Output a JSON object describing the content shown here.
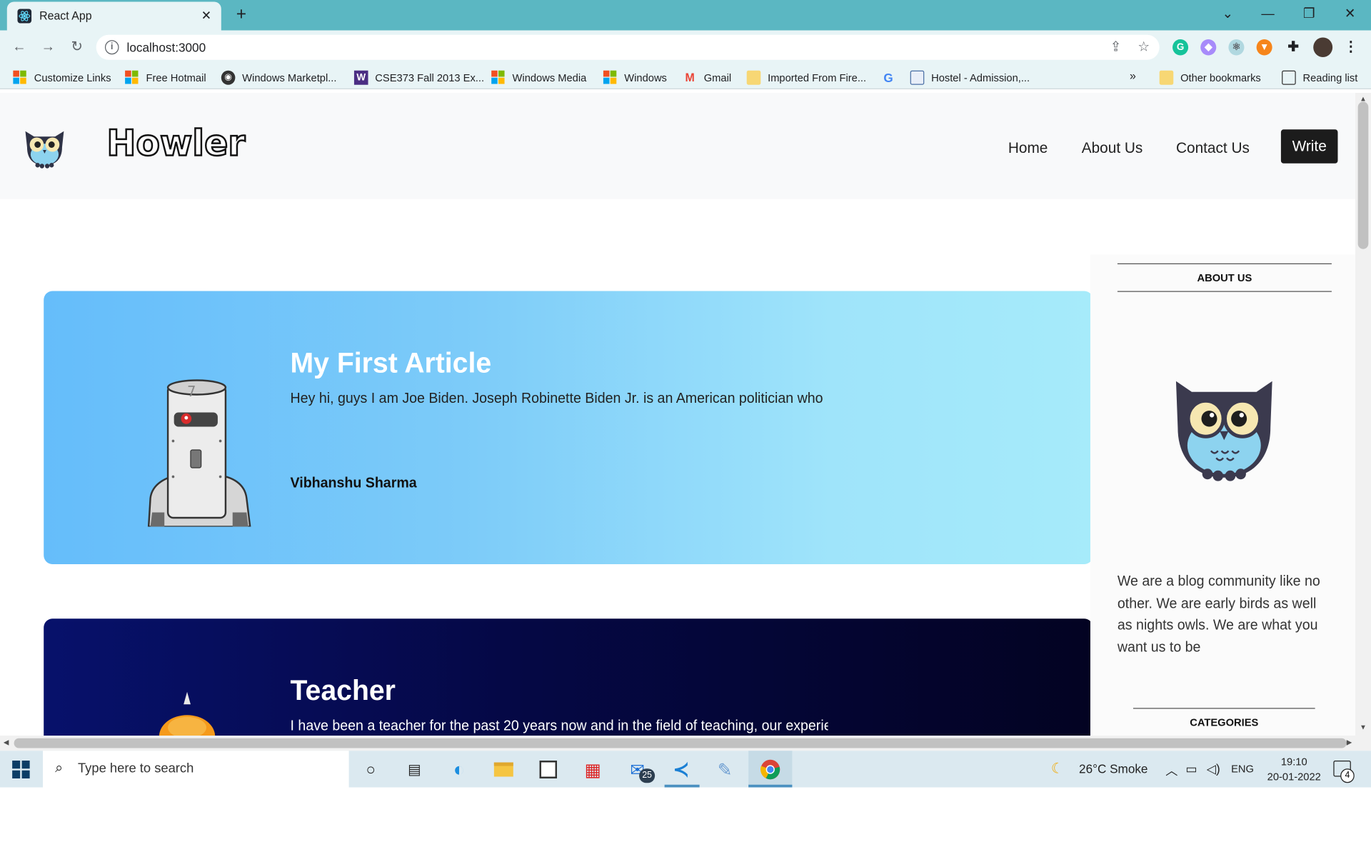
{
  "browser": {
    "tab_title": "React App",
    "url": "localhost:3000",
    "bookmarks": [
      {
        "label": "Customize Links",
        "icon": "microsoft-icon"
      },
      {
        "label": "Free Hotmail",
        "icon": "microsoft-icon"
      },
      {
        "label": "Windows Marketpl...",
        "icon": "globe-icon"
      },
      {
        "label": "CSE373 Fall 2013 Ex...",
        "icon": "w-icon"
      },
      {
        "label": "Windows Media",
        "icon": "microsoft-icon"
      },
      {
        "label": "Windows",
        "icon": "microsoft-icon"
      },
      {
        "label": "Gmail",
        "icon": "gmail-icon"
      },
      {
        "label": "Imported From Fire...",
        "icon": "folder-icon"
      },
      {
        "label": "Hostel - Admission,...",
        "icon": "page-icon"
      }
    ],
    "bookmarks_more": "»",
    "other_bookmarks": "Other bookmarks",
    "reading_list": "Reading list"
  },
  "site": {
    "brand": "Howler",
    "nav": {
      "home": "Home",
      "about": "About Us",
      "contact": "Contact Us",
      "write": "Write"
    }
  },
  "posts": [
    {
      "title": "My First Article",
      "excerpt": "Hey hi, guys I am Joe Biden. Joseph Robinette Biden Jr. is an American politician who",
      "author": "Vibhanshu Sharma"
    },
    {
      "title": "Teacher",
      "excerpt": "I have been a teacher for the past 20 years now and in the field of teaching, our experience"
    }
  ],
  "sidebar": {
    "about_heading": "ABOUT US",
    "about_text": "We are a blog community like no other. We are early birds as well as nights owls. We are what you want us to be",
    "categories_heading": "CATEGORIES"
  },
  "taskbar": {
    "search_placeholder": "Type here to search",
    "mail_badge": "25",
    "weather": "26°C  Smoke",
    "language": "ENG",
    "time": "19:10",
    "date": "20-01-2022",
    "notifications": "4"
  },
  "colors": {
    "browser_accent": "#5bb7c2",
    "card1_gradient_start": "#65bdfa",
    "card1_gradient_end": "#a6ebfa",
    "card2_gradient_start": "#07116b",
    "card2_gradient_end": "#030322",
    "write_button": "#1c1c1c"
  }
}
